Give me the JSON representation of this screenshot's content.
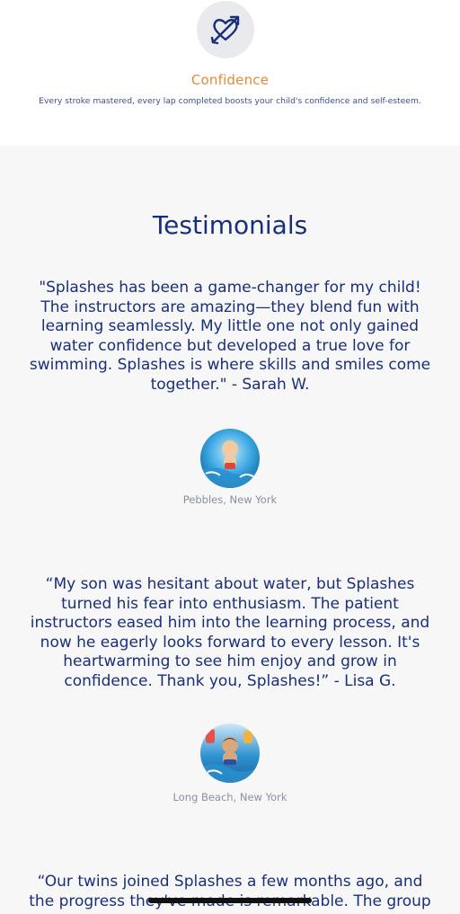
{
  "feature": {
    "icon": "heart-arrow-icon",
    "title": "Confidence",
    "description": "Every stroke mastered, every lap completed boosts your child's confidence and self-esteem."
  },
  "testimonials": {
    "heading": "Testimonials",
    "items": [
      {
        "quote": "\"Splashes has been a game-changer for my child! The instructors are amazing—they blend fun with learning seamlessly. My little one not only gained water confidence but developed a true love for swimming. Splashes is where skills and smiles come together.\" - Sarah W.",
        "location": "Pebbles, New York"
      },
      {
        "quote": "“My son was hesitant about water, but Splashes turned his fear into enthusiasm. The patient instructors eased him into the learning process, and now he eagerly looks forward to every lesson. It's heartwarming to see him enjoy and grow in confidence. Thank you, Splashes!” - Lisa G.",
        "location": "Long Beach, New York"
      },
      {
        "quote": "“Our twins joined Splashes a few months ago, and the progress they've made is remarkable. The group"
      }
    ]
  },
  "colors": {
    "accent": "#e08a3c",
    "navy": "#1a2f7a",
    "background": "#f7f7f7"
  }
}
